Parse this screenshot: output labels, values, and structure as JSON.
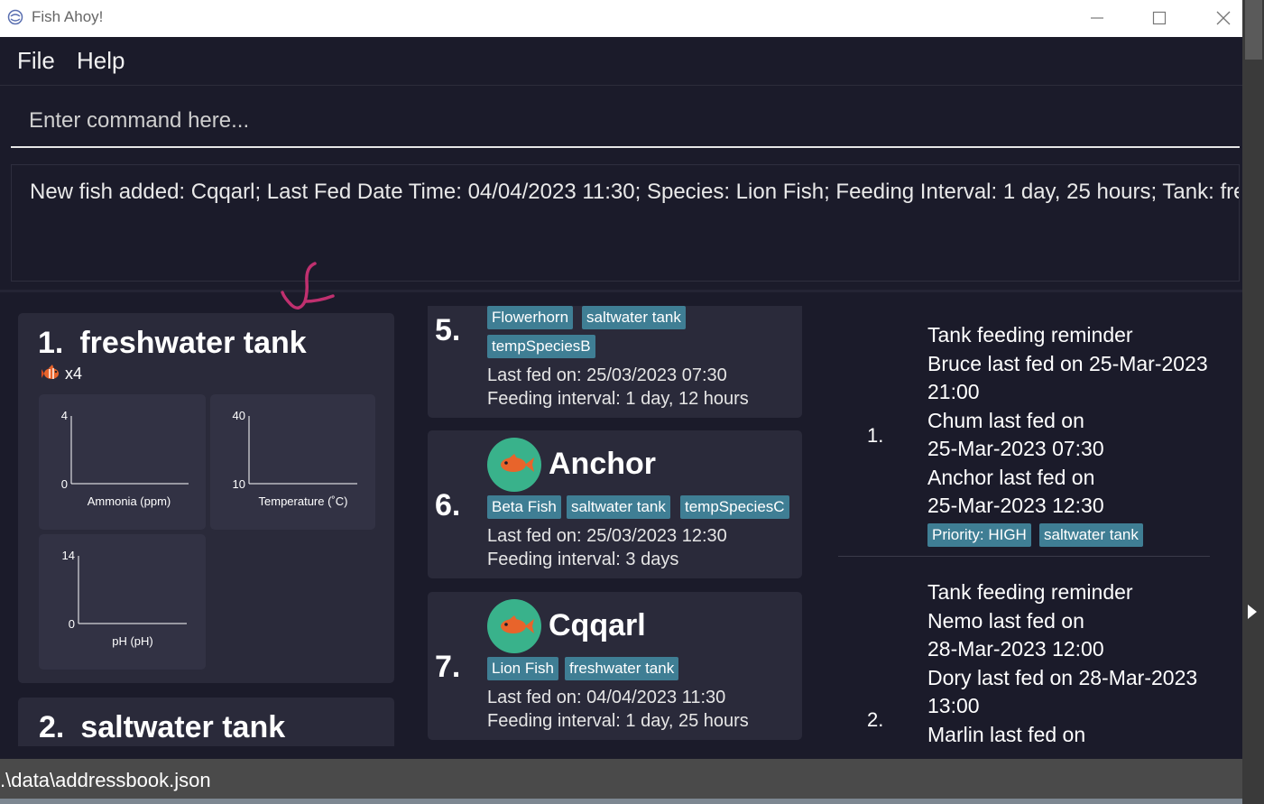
{
  "window": {
    "title": "Fish Ahoy!"
  },
  "menu": {
    "file": "File",
    "help": "Help"
  },
  "command": {
    "placeholder": "Enter command here..."
  },
  "result": {
    "text": "New fish added: Cqqarl; Last Fed Date Time: 04/04/2023 11:30; Species: Lion Fish; Feeding Interval: 1 day, 25 hours; Tank: freshwater tank"
  },
  "tanks": [
    {
      "index": "1.",
      "name": "freshwater tank",
      "fish_count": "x4",
      "graphs": [
        {
          "label": "Ammonia (ppm)",
          "y_max": "4",
          "y_min": "0"
        },
        {
          "label": "Temperature (˚C)",
          "y_max": "40",
          "y_min": "10"
        },
        {
          "label": "pH (pH)",
          "y_max": "14",
          "y_min": "0"
        }
      ]
    },
    {
      "index": "2.",
      "name": "saltwater tank"
    }
  ],
  "fishes": [
    {
      "index": "5.",
      "tags": [
        "Flowerhorn",
        "saltwater tank",
        "tempSpeciesB"
      ],
      "last_fed": "Last fed on: 25/03/2023 07:30",
      "interval": "Feeding interval: 1 day, 12 hours"
    },
    {
      "index": "6.",
      "name": "Anchor",
      "tags": [
        "Beta Fish",
        "saltwater tank",
        "tempSpeciesC"
      ],
      "last_fed": "Last fed on: 25/03/2023 12:30",
      "interval": "Feeding interval: 3 days"
    },
    {
      "index": "7.",
      "name": "Cqqarl",
      "tags": [
        "Lion Fish",
        "freshwater tank"
      ],
      "last_fed": "Last fed on: 04/04/2023 11:30",
      "interval": "Feeding interval: 1 day, 25 hours"
    }
  ],
  "reminders": [
    {
      "index": "1.",
      "lines": [
        "Tank feeding reminder",
        "Bruce last fed on 25-Mar-2023",
        "21:00",
        "Chum last fed on",
        "25-Mar-2023 07:30",
        "Anchor last fed on",
        "25-Mar-2023 12:30"
      ],
      "tags": [
        "Priority: HIGH",
        "saltwater tank"
      ]
    },
    {
      "index": "2.",
      "lines": [
        "Tank feeding reminder",
        "Nemo last fed on",
        "28-Mar-2023 12:00",
        "Dory last fed on 28-Mar-2023",
        "13:00",
        "Marlin last fed on"
      ]
    }
  ],
  "status": {
    "path": ".\\data\\addressbook.json"
  },
  "colors": {
    "background": "#1b1b2a",
    "card": "#2a2a3a",
    "tag": "#3f7e94",
    "avatar": "#39b28b",
    "fish": "#e8642b",
    "annotation": "#c0306f"
  },
  "icons": [
    "app-icon",
    "minimize-icon",
    "maximize-icon",
    "close-icon",
    "fish-icon",
    "expand-arrow-icon"
  ]
}
